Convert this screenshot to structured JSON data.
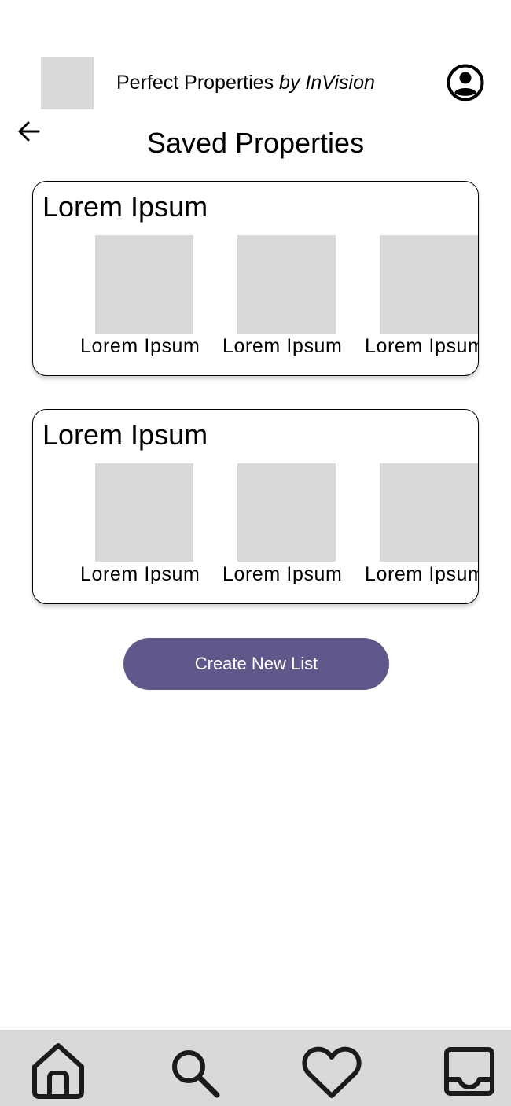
{
  "header": {
    "brand_name": "Perfect Properties",
    "brand_suffix": "by InVision"
  },
  "page": {
    "title": "Saved Properties"
  },
  "lists": [
    {
      "title": "Lorem Ipsum",
      "properties": [
        {
          "label": "Lorem Ipsum"
        },
        {
          "label": "Lorem Ipsum"
        },
        {
          "label": "Lorem Ipsum"
        }
      ]
    },
    {
      "title": "Lorem Ipsum",
      "properties": [
        {
          "label": "Lorem Ipsum"
        },
        {
          "label": "Lorem Ipsum"
        },
        {
          "label": "Lorem Ipsum"
        }
      ]
    }
  ],
  "actions": {
    "create_list_label": "Create New List"
  },
  "bottom_nav": {
    "items": [
      {
        "icon": "home-icon"
      },
      {
        "icon": "search-icon"
      },
      {
        "icon": "heart-icon"
      },
      {
        "icon": "inbox-icon"
      }
    ]
  },
  "colors": {
    "accent": "#62578a",
    "placeholder": "#d9d9d9",
    "nav_background": "#d9d9d9"
  }
}
